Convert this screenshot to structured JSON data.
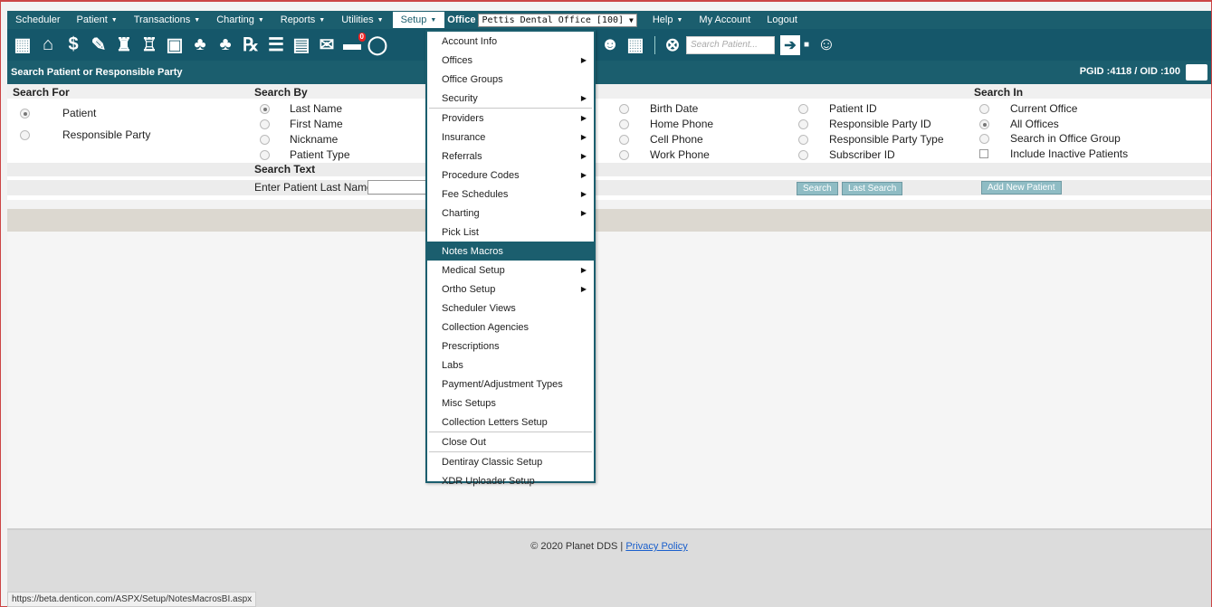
{
  "menu": {
    "items": [
      {
        "label": "Scheduler",
        "caret": false
      },
      {
        "label": "Patient",
        "caret": true
      },
      {
        "label": "Transactions",
        "caret": true
      },
      {
        "label": "Charting",
        "caret": true
      },
      {
        "label": "Reports",
        "caret": true
      },
      {
        "label": "Utilities",
        "caret": true
      }
    ],
    "setup_label": "Setup",
    "office_label": "Office",
    "office_value": "Pettis Dental Office [100]",
    "help_label": "Help",
    "my_account_label": "My Account",
    "logout_label": "Logout"
  },
  "toolbar": {
    "search_placeholder": "Search Patient...",
    "badge_count": "0"
  },
  "title": {
    "text": "Search Patient or Responsible Party",
    "pgid": "PGID :4118 / OID :100"
  },
  "search": {
    "search_for_head": "Search For",
    "search_by_head": "Search By",
    "search_in_head": "Search In",
    "search_text_head": "Search Text",
    "search_for": [
      "Patient",
      "Responsible Party"
    ],
    "search_by_col1": [
      "Last Name",
      "First Name",
      "Nickname",
      "Patient Type"
    ],
    "search_by_col2": [
      "Birth Date",
      "Home Phone",
      "Cell Phone",
      "Work Phone"
    ],
    "search_by_col3": [
      "Patient ID",
      "Responsible Party ID",
      "Responsible Party Type",
      "Subscriber ID"
    ],
    "search_in": [
      "Current Office",
      "All Offices",
      "Search in Office Group"
    ],
    "include_inactive": "Include Inactive Patients",
    "enter_label": "Enter Patient Last Name:",
    "search_btn": "Search",
    "last_search_btn": "Last Search",
    "add_patient_btn": "Add New Patient"
  },
  "setup_menu": [
    {
      "label": "Account Info",
      "sub": false
    },
    {
      "label": "Offices",
      "sub": true
    },
    {
      "label": "Office Groups",
      "sub": false
    },
    {
      "label": "Security",
      "sub": true,
      "sep_after": true
    },
    {
      "label": "Providers",
      "sub": true
    },
    {
      "label": "Insurance",
      "sub": true
    },
    {
      "label": "Referrals",
      "sub": true
    },
    {
      "label": "Procedure Codes",
      "sub": true
    },
    {
      "label": "Fee Schedules",
      "sub": true
    },
    {
      "label": "Charting",
      "sub": true
    },
    {
      "label": "Pick List",
      "sub": false
    },
    {
      "label": "Notes Macros",
      "sub": false,
      "highlight": true
    },
    {
      "label": "Medical Setup",
      "sub": true
    },
    {
      "label": "Ortho Setup",
      "sub": true
    },
    {
      "label": "Scheduler Views",
      "sub": false
    },
    {
      "label": "Collection Agencies",
      "sub": false
    },
    {
      "label": "Prescriptions",
      "sub": false
    },
    {
      "label": "Labs",
      "sub": false
    },
    {
      "label": "Payment/Adjustment Types",
      "sub": false
    },
    {
      "label": "Misc Setups",
      "sub": false
    },
    {
      "label": "Collection Letters Setup",
      "sub": false,
      "sep_after": true
    },
    {
      "label": "Close Out",
      "sub": false,
      "sep_after": true
    },
    {
      "label": "Dentiray Classic Setup",
      "sub": false
    },
    {
      "label": "XDR Uploader Setup",
      "sub": false
    }
  ],
  "footer": {
    "copyright": "© 2020 Planet DDS |",
    "privacy": "Privacy Policy"
  },
  "status_url": "https://beta.denticon.com/ASPX/Setup/NotesMacrosBI.aspx",
  "colors": {
    "primary": "#1b5e6e",
    "button": "#8fbcc4"
  }
}
